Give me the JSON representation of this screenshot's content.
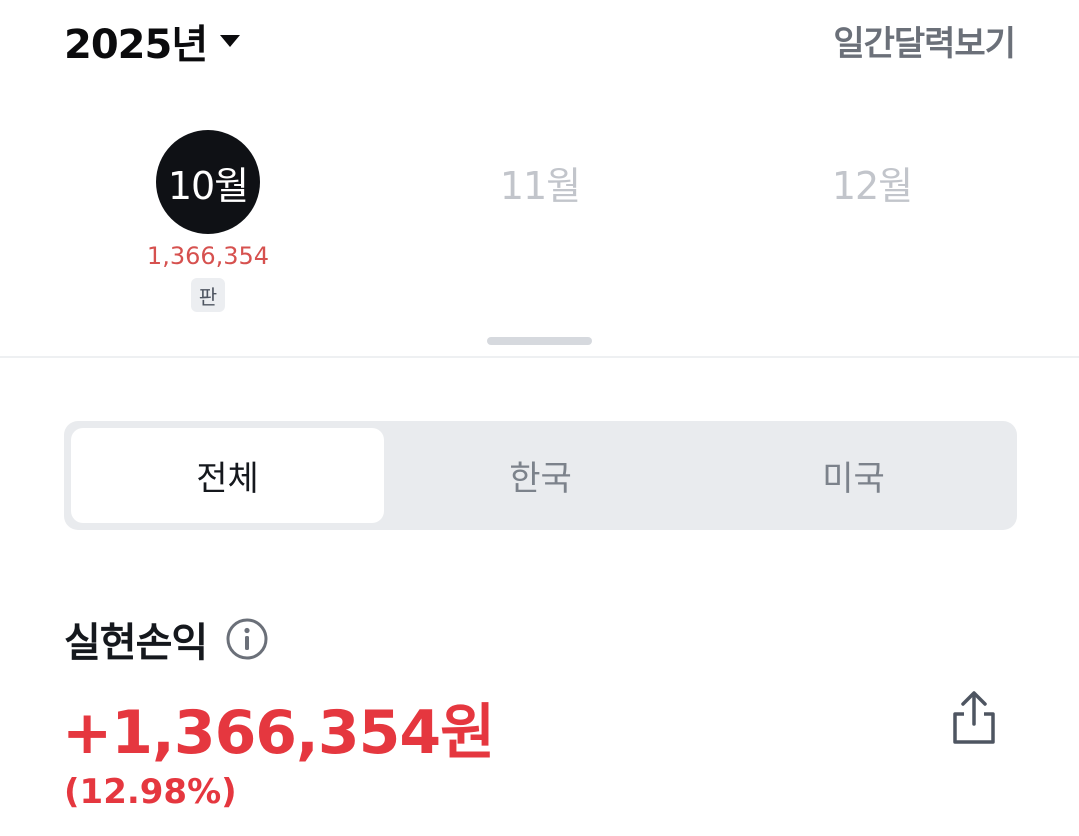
{
  "header": {
    "year_label": "2025년",
    "calendar_link": "일간달력보기"
  },
  "months": [
    {
      "label": "10월",
      "amount": "1,366,354",
      "badge": "판",
      "active": true
    },
    {
      "label": "11월",
      "active": false
    },
    {
      "label": "12월",
      "active": false
    }
  ],
  "segments": {
    "tabs": [
      "전체",
      "한국",
      "미국"
    ],
    "selected": "전체"
  },
  "pnl": {
    "title": "실현손익",
    "amount": "+1,366,354원",
    "percent": "(12.98%)"
  },
  "colors": {
    "profit_red": "#e5373f",
    "active_month_bg": "#0f1115",
    "inactive_month_text": "#c2c5cb"
  },
  "icons": [
    "caret-down-icon",
    "info-icon",
    "share-icon"
  ]
}
